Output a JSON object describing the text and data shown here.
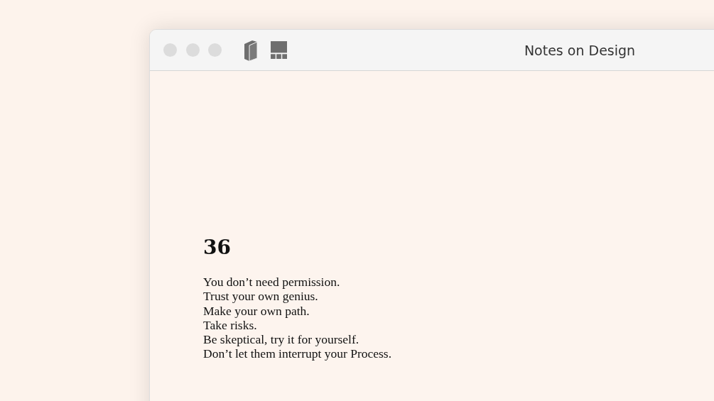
{
  "window": {
    "title": "Notes on Design"
  },
  "page": {
    "heading": "36",
    "lines": [
      "You don’t need permission.",
      "Trust your own genius.",
      "Make your own path.",
      "Take risks.",
      "Be skeptical, try it for yourself.",
      "Don’t let them interrupt your Process."
    ]
  }
}
